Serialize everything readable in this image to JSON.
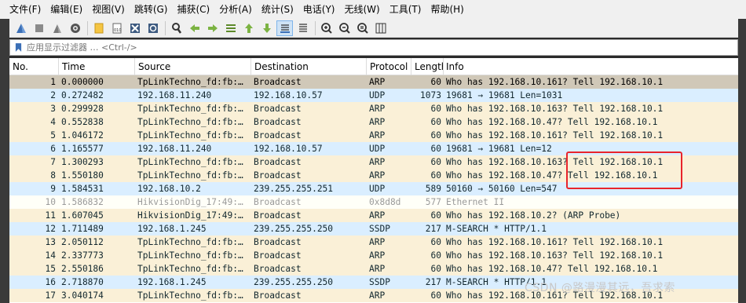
{
  "menu": [
    "文件(F)",
    "编辑(E)",
    "视图(V)",
    "跳转(G)",
    "捕获(C)",
    "分析(A)",
    "统计(S)",
    "电话(Y)",
    "无线(W)",
    "工具(T)",
    "帮助(H)"
  ],
  "toolbar": {
    "icons": [
      "shark-fin-start-icon",
      "stop-icon",
      "restart-icon",
      "options-gear-icon",
      "open-file-icon",
      "save-file-icon",
      "close-file-icon",
      "reload-icon",
      "find-icon",
      "go-back-icon",
      "go-forward-icon",
      "go-to-packet-icon",
      "go-first-icon",
      "go-last-icon",
      "autoscroll-icon",
      "colorize-icon",
      "zoom-in-icon",
      "zoom-out-icon",
      "zoom-normal-icon",
      "resize-columns-icon"
    ]
  },
  "filter": {
    "placeholder": "应用显示过滤器 … <Ctrl-/>"
  },
  "columns": {
    "no": "No.",
    "time": "Time",
    "source": "Source",
    "destination": "Destination",
    "protocol": "Protocol",
    "length": "Length",
    "info": "Info"
  },
  "packets": [
    {
      "no": "1",
      "time": "0.000000",
      "source": "TpLinkTechno_fd:fb:…",
      "destination": "Broadcast",
      "protocol": "ARP",
      "length": "60",
      "info": "Who has 192.168.10.161? Tell 192.168.10.1",
      "kind": "selected"
    },
    {
      "no": "2",
      "time": "0.272482",
      "source": "192.168.11.240",
      "destination": "192.168.10.57",
      "protocol": "UDP",
      "length": "1073",
      "info": "19681 → 19681 Len=1031",
      "kind": "udp"
    },
    {
      "no": "3",
      "time": "0.299928",
      "source": "TpLinkTechno_fd:fb:…",
      "destination": "Broadcast",
      "protocol": "ARP",
      "length": "60",
      "info": "Who has 192.168.10.163? Tell 192.168.10.1",
      "kind": "arp"
    },
    {
      "no": "4",
      "time": "0.552838",
      "source": "TpLinkTechno_fd:fb:…",
      "destination": "Broadcast",
      "protocol": "ARP",
      "length": "60",
      "info": "Who has 192.168.10.47? Tell 192.168.10.1",
      "kind": "arp"
    },
    {
      "no": "5",
      "time": "1.046172",
      "source": "TpLinkTechno_fd:fb:…",
      "destination": "Broadcast",
      "protocol": "ARP",
      "length": "60",
      "info": "Who has 192.168.10.161? Tell 192.168.10.1",
      "kind": "arp"
    },
    {
      "no": "6",
      "time": "1.165577",
      "source": "192.168.11.240",
      "destination": "192.168.10.57",
      "protocol": "UDP",
      "length": "60",
      "info": "19681 → 19681 Len=12",
      "kind": "udp"
    },
    {
      "no": "7",
      "time": "1.300293",
      "source": "TpLinkTechno_fd:fb:…",
      "destination": "Broadcast",
      "protocol": "ARP",
      "length": "60",
      "info": "Who has 192.168.10.163? Tell 192.168.10.1",
      "kind": "arp"
    },
    {
      "no": "8",
      "time": "1.550180",
      "source": "TpLinkTechno_fd:fb:…",
      "destination": "Broadcast",
      "protocol": "ARP",
      "length": "60",
      "info": "Who has 192.168.10.47? Tell 192.168.10.1",
      "kind": "arp"
    },
    {
      "no": "9",
      "time": "1.584531",
      "source": "192.168.10.2",
      "destination": "239.255.255.251",
      "protocol": "UDP",
      "length": "589",
      "info": "50160 → 50160 Len=547",
      "kind": "udp"
    },
    {
      "no": "10",
      "time": "1.586832",
      "source": "HikvisionDig_17:49:…",
      "destination": "Broadcast",
      "protocol": "0x8d8d",
      "length": "577",
      "info": "Ethernet II",
      "kind": "unknown"
    },
    {
      "no": "11",
      "time": "1.607045",
      "source": "HikvisionDig_17:49:…",
      "destination": "Broadcast",
      "protocol": "ARP",
      "length": "60",
      "info": "Who has 192.168.10.2? (ARP Probe)",
      "kind": "arp"
    },
    {
      "no": "12",
      "time": "1.711489",
      "source": "192.168.1.245",
      "destination": "239.255.255.250",
      "protocol": "SSDP",
      "length": "217",
      "info": "M-SEARCH * HTTP/1.1",
      "kind": "ssdp"
    },
    {
      "no": "13",
      "time": "2.050112",
      "source": "TpLinkTechno_fd:fb:…",
      "destination": "Broadcast",
      "protocol": "ARP",
      "length": "60",
      "info": "Who has 192.168.10.161? Tell 192.168.10.1",
      "kind": "arp"
    },
    {
      "no": "14",
      "time": "2.337773",
      "source": "TpLinkTechno_fd:fb:…",
      "destination": "Broadcast",
      "protocol": "ARP",
      "length": "60",
      "info": "Who has 192.168.10.163? Tell 192.168.10.1",
      "kind": "arp"
    },
    {
      "no": "15",
      "time": "2.550186",
      "source": "TpLinkTechno_fd:fb:…",
      "destination": "Broadcast",
      "protocol": "ARP",
      "length": "60",
      "info": "Who has 192.168.10.47? Tell 192.168.10.1",
      "kind": "arp"
    },
    {
      "no": "16",
      "time": "2.718870",
      "source": "192.168.1.245",
      "destination": "239.255.255.250",
      "protocol": "SSDP",
      "length": "217",
      "info": "M-SEARCH * HTTP/1.1",
      "kind": "ssdp"
    },
    {
      "no": "17",
      "time": "3.040174",
      "source": "TpLinkTechno_fd:fb:…",
      "destination": "Broadcast",
      "protocol": "ARP",
      "length": "60",
      "info": "Who has 192.168.10.161? Tell 192.168.10.1",
      "kind": "arp"
    }
  ],
  "watermark": "CSDN @路漫漫其远，吾求索",
  "colors": {
    "arp_row": "#faf0d7",
    "udp_row": "#daeeff",
    "selected_row": "#d0c8b8",
    "highlight": "#e8242b"
  }
}
